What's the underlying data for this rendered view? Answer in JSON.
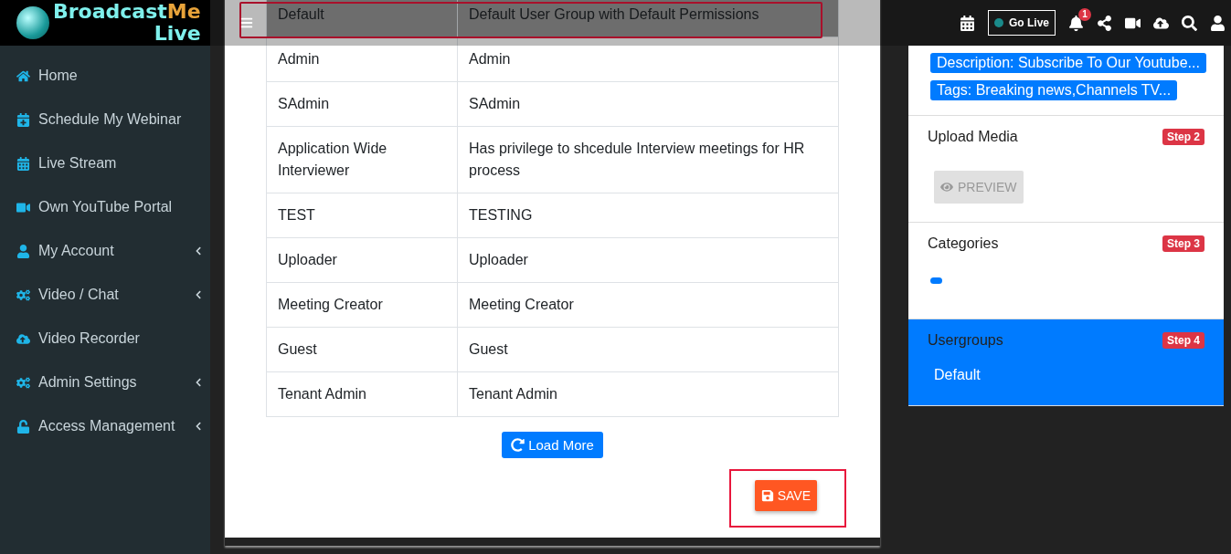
{
  "logo": {
    "parts": [
      "Broadcast",
      "Me"
    ],
    "second_line": "Live"
  },
  "sidebar": {
    "items": [
      {
        "label": "Home",
        "has_submenu": false
      },
      {
        "label": "Schedule My Webinar",
        "has_submenu": false
      },
      {
        "label": "Live Stream",
        "has_submenu": false
      },
      {
        "label": "Own YouTube Portal",
        "has_submenu": false
      },
      {
        "label": "My Account",
        "has_submenu": true
      },
      {
        "label": "Video / Chat",
        "has_submenu": true
      },
      {
        "label": "Video Recorder",
        "has_submenu": false
      },
      {
        "label": "Admin Settings",
        "has_submenu": true
      },
      {
        "label": "Access Management",
        "has_submenu": true
      }
    ]
  },
  "header": {
    "go_live": "Go Live",
    "live_on": false,
    "notification_count": "1"
  },
  "table": {
    "highlighted_row": true,
    "rows": [
      {
        "name": "Default",
        "description": "Default User Group with Default Permissions",
        "selected": true
      },
      {
        "name": "Admin",
        "description": "Admin",
        "selected": false
      },
      {
        "name": "SAdmin",
        "description": "SAdmin",
        "selected": false
      },
      {
        "name": "Application Wide Interviewer",
        "description": "Has privilege to shcedule Interview meetings for HR process",
        "selected": false
      },
      {
        "name": "TEST",
        "description": "TESTING",
        "selected": false
      },
      {
        "name": "Uploader",
        "description": "Uploader",
        "selected": false
      },
      {
        "name": "Meeting Creator",
        "description": "Meeting Creator",
        "selected": false
      },
      {
        "name": "Guest",
        "description": "Guest",
        "selected": false
      },
      {
        "name": "Tenant Admin",
        "description": "Tenant Admin",
        "selected": false
      }
    ]
  },
  "load_more": "Load More",
  "save": {
    "label": "SAVE",
    "highlighted": true
  },
  "details": {
    "tags": [
      "Description: Subscribe To Our Youtube...",
      "Tags: Breaking news,Channels TV..."
    ],
    "sections": [
      {
        "kind": "upload",
        "title": "Upload Media",
        "step": "Step 2",
        "selected": false,
        "button": "PREVIEW",
        "button_disabled": true
      },
      {
        "kind": "chips",
        "title": "Categories",
        "step": "Step 3",
        "selected": false
      },
      {
        "kind": "list",
        "title": "Usergroups",
        "step": "Step 4",
        "selected": true,
        "items": [
          "Default"
        ]
      }
    ]
  }
}
